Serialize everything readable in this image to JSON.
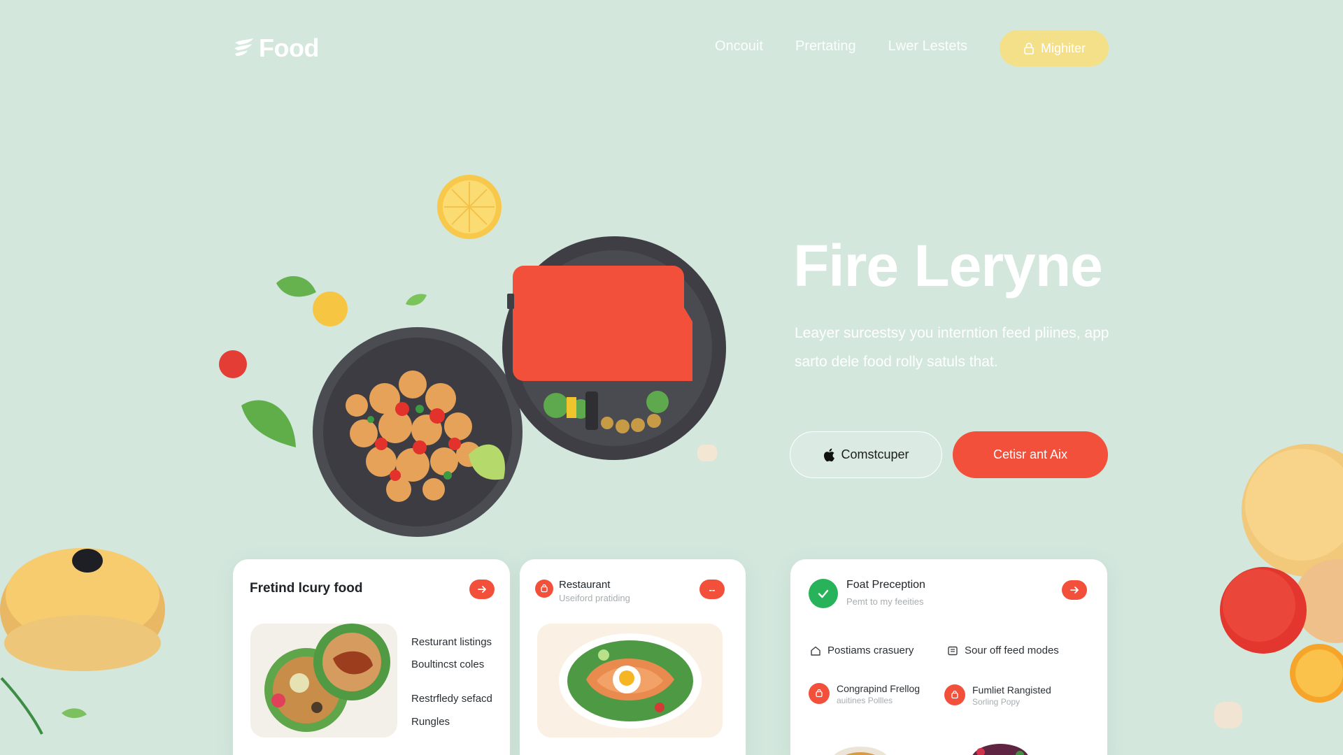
{
  "brand": {
    "name": "Food"
  },
  "nav": {
    "links": [
      "Oncouit",
      "Prertating",
      "Lwer Lestets"
    ],
    "cta_label": "Mighiter"
  },
  "hero": {
    "title": "Fire Leryne",
    "description": "Leayer surcestsy you interntion feed pliines, app sarto dele food rolly satuls that.",
    "btn_secondary": "Comstcuper",
    "btn_primary": "Cetisr ant Aix"
  },
  "cards": {
    "card1": {
      "title": "Fretind lcury food",
      "items": [
        "Resturant listings",
        "Boultincst coles",
        "Restrfledy sefacd",
        "Rungles"
      ]
    },
    "card2": {
      "title": "Restaurant",
      "subtitle": "Useiford pratiding",
      "button": "--"
    },
    "card3": {
      "title": "Foat Preception",
      "subtitle": "Pemt to my feeities",
      "features": [
        "Postiams crasuery",
        "Sour off feed modes"
      ],
      "rows": [
        {
          "title": "Congrapind Frellog",
          "subtitle": "auitines Pollles"
        },
        {
          "title": "Fumliet Rangisted",
          "subtitle": "Sorling Popy"
        }
      ]
    }
  },
  "colors": {
    "background": "#d3e7dd",
    "accent": "#f2503b",
    "cta_yellow": "#f5e08a",
    "success": "#28b35b"
  },
  "icons": [
    "leaf-logo-icon",
    "lock-icon",
    "apple-icon",
    "arrow-right-icon",
    "check-icon",
    "home-icon",
    "list-icon",
    "bag-icon"
  ]
}
